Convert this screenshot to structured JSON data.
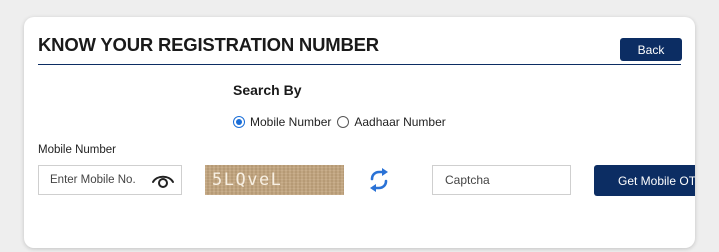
{
  "header": {
    "title": "KNOW YOUR REGISTRATION NUMBER",
    "back_label": "Back"
  },
  "search": {
    "heading": "Search By",
    "options": [
      {
        "label": "Mobile Number",
        "checked": true
      },
      {
        "label": "Aadhaar Number",
        "checked": false
      }
    ]
  },
  "mobile": {
    "label": "Mobile Number",
    "placeholder": "Enter Mobile No.",
    "value": ""
  },
  "captcha": {
    "image_text": "5LQveL",
    "placeholder": "Captcha",
    "value": ""
  },
  "actions": {
    "get_label": "Get Mobile OTP"
  },
  "colors": {
    "primary": "#0c2d63",
    "radio_accent": "#1a6ed8",
    "refresh_icon": "#2a72d6",
    "captcha_bg": "#c3a57e"
  },
  "icons": {
    "eye": "eye-icon",
    "refresh": "refresh-icon"
  }
}
